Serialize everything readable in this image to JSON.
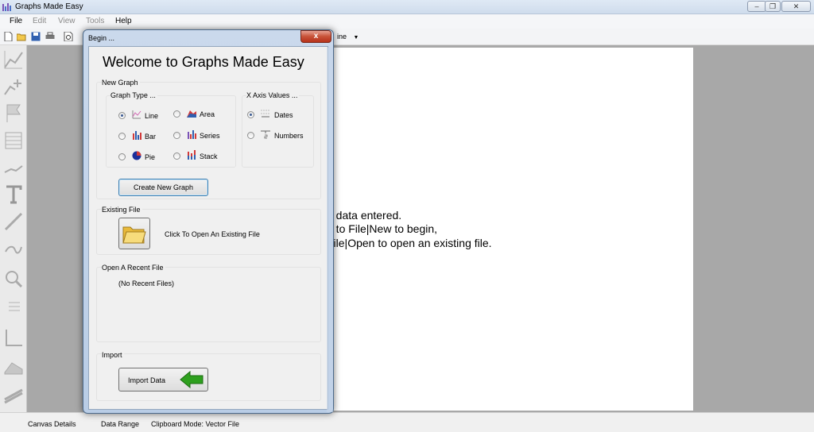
{
  "window": {
    "title": "Graphs Made Easy"
  },
  "menu": [
    "File",
    "Edit",
    "View",
    "Tools",
    "Help"
  ],
  "toolbar": {
    "dropdown_partial": "ine"
  },
  "canvas_message": [
    "o data entered.",
    "o to File|New to begin,",
    "File|Open to open an existing file."
  ],
  "status": {
    "canvas": "Canvas Details",
    "range": "Data Range",
    "clipboard": "Clipboard Mode: Vector File"
  },
  "dialog": {
    "title": "Begin ...",
    "close_label": "x",
    "welcome": "Welcome to Graphs Made Easy",
    "new_graph": {
      "label": "New Graph",
      "graph_type_label": "Graph Type ...",
      "types": [
        "Line",
        "Area",
        "Bar",
        "Series",
        "Pie",
        "Stack"
      ],
      "xaxis_label": "X Axis Values ...",
      "xaxis_options": [
        "Dates",
        "Numbers"
      ],
      "create_button": "Create New Graph"
    },
    "existing": {
      "label": "Existing File",
      "open_text": "Click To Open An Existing File"
    },
    "recent": {
      "label": "Open A Recent File",
      "empty": "(No Recent Files)"
    },
    "import": {
      "label": "Import",
      "button": "Import Data"
    }
  },
  "colors": {
    "accent": "#3a5a92",
    "close_red": "#c75238",
    "arrow_green": "#2ea01e"
  }
}
